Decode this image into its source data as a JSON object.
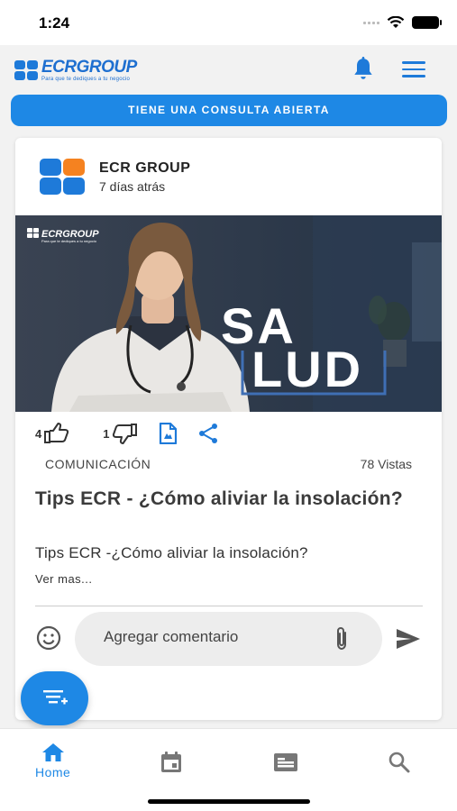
{
  "status_bar": {
    "time": "1:24"
  },
  "header": {
    "logo_title_a": "ECR",
    "logo_title_b": "GROUP",
    "logo_tagline": "Para que te dediques a tu negocio",
    "icons": [
      "bell-icon",
      "menu-icon"
    ]
  },
  "banner": {
    "label": "TIENE UNA CONSULTA ABIERTA"
  },
  "post": {
    "author": "ECR GROUP",
    "time_ago": "7 días atrás",
    "image": {
      "logo_a": "ECR",
      "logo_b": "GROUP",
      "tagline": "Para que te dediques a tu negocio",
      "line1": "SA",
      "line2": "LUD"
    },
    "likes": "4",
    "dislikes": "1",
    "category": "COMUNICACIÓN",
    "views": "78 Vistas",
    "title": "Tips ECR - ¿Cómo aliviar la insolación?",
    "subtitle": "Tips ECR -¿Cómo aliviar la insolación?",
    "see_more": "Ver mas..."
  },
  "comment": {
    "placeholder": "Agregar comentario"
  },
  "bottom_nav": {
    "items": [
      {
        "label": "Home",
        "icon": "home-icon",
        "active": true
      },
      {
        "label": "",
        "icon": "calendar-icon",
        "active": false
      },
      {
        "label": "",
        "icon": "card-icon",
        "active": false
      },
      {
        "label": "",
        "icon": "search-icon",
        "active": false
      }
    ]
  },
  "colors": {
    "accent": "#1e88e5",
    "brand_blue": "#1e7ad9",
    "brand_orange": "#f58220"
  }
}
